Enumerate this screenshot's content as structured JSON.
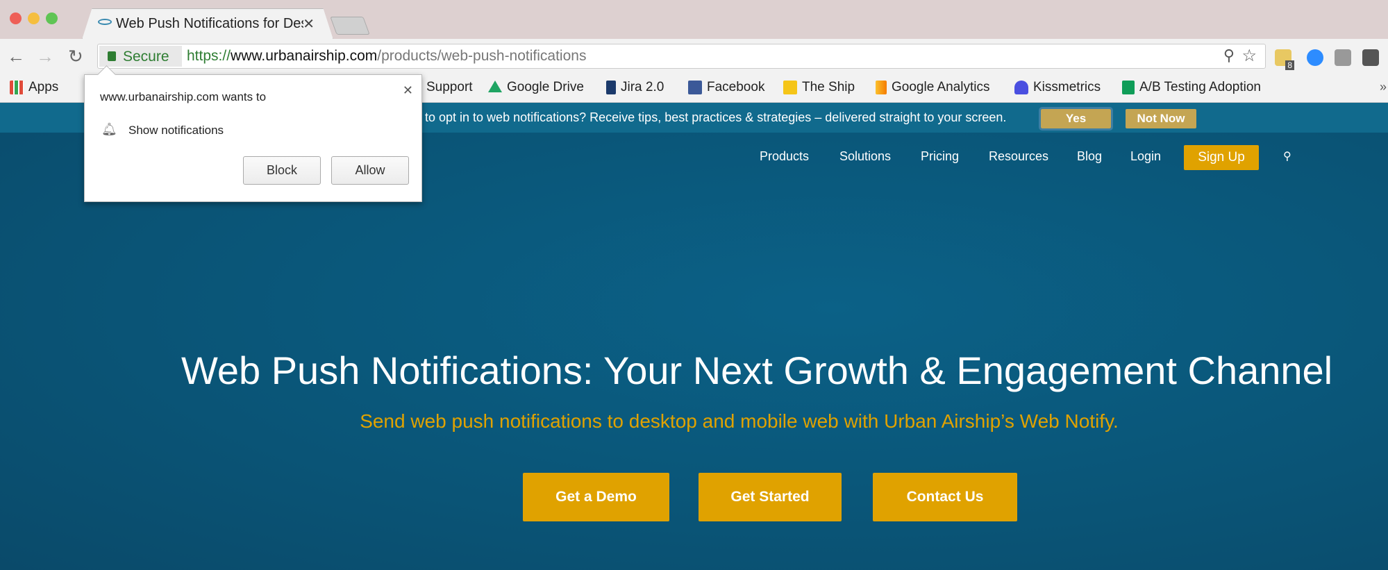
{
  "browser": {
    "tab_title": "Web Push Notifications for Desktop",
    "secure_label": "Secure",
    "url_scheme": "https://",
    "url_domain": "www.urbanairship.com",
    "url_path": "/products/web-push-notifications",
    "extension_badge": "8"
  },
  "bookmarks": [
    {
      "label": "Apps",
      "color": "#e04b3a"
    },
    {
      "label": "Support",
      "color": "#888"
    },
    {
      "label": "Google Drive",
      "color": "#1fa463"
    },
    {
      "label": "Jira 2.0",
      "color": "#1b3a6b"
    },
    {
      "label": "Facebook",
      "color": "#3b5998"
    },
    {
      "label": "The Ship",
      "color": "#f5c518"
    },
    {
      "label": "Google Analytics",
      "color": "#f57c00"
    },
    {
      "label": "Kissmetrics",
      "color": "#4a4fe0"
    },
    {
      "label": "A/B Testing Adoption",
      "color": "#0f9d58"
    }
  ],
  "banner": {
    "text": "to opt in to web notifications? Receive tips, best practices & strategies – delivered straight to your screen.",
    "yes": "Yes",
    "not_now": "Not Now"
  },
  "nav": {
    "items": [
      "Products",
      "Solutions",
      "Pricing",
      "Resources",
      "Blog",
      "Login"
    ],
    "signup": "Sign Up"
  },
  "hero": {
    "title": "Web Push Notifications: Your Next Growth & Engagement Channel",
    "subtitle": "Send web push notifications to desktop and mobile web with Urban Airship’s Web Notify.",
    "buttons": [
      "Get a Demo",
      "Get Started",
      "Contact Us"
    ]
  },
  "popup": {
    "heading": "www.urbanairship.com wants to",
    "permission": "Show notifications",
    "block": "Block",
    "allow": "Allow"
  },
  "colors": {
    "accent": "#e0a200",
    "banner": "#116a8d",
    "hero": "#0a5476"
  }
}
